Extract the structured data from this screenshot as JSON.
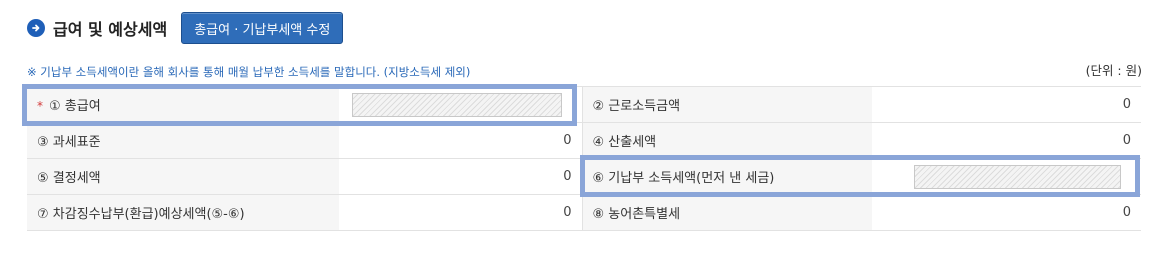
{
  "section": {
    "title": "급여 및 예상세액",
    "edit_button": "총급여 · 기납부세액 수정"
  },
  "notice": "※ 기납부 소득세액이란 올해 회사를 통해 매월 납부한 소득세를 말합니다. (지방소득세 제외)",
  "unit": "(단위 : 원)",
  "rows": [
    {
      "left_label": "① 총급여",
      "left_required_mark": "*",
      "left_value": "",
      "right_label": "② 근로소득금액",
      "right_value": "0"
    },
    {
      "left_label": "③ 과세표준",
      "left_value": "0",
      "right_label": "④ 산출세액",
      "right_value": "0"
    },
    {
      "left_label": "⑤ 결정세액",
      "left_value": "0",
      "right_label": "⑥ 기납부 소득세액(먼저 낸 세금)",
      "right_value": ""
    },
    {
      "left_label": "⑦ 차감징수납부(환급)예상세액(⑤-⑥)",
      "left_value": "0",
      "right_label": "⑧ 농어촌특별세",
      "right_value": "0"
    }
  ],
  "colors": {
    "accent": "#2f6db9",
    "highlight": "#8aa5d8",
    "required": "#d23a3a"
  },
  "icons": {
    "section_icon": "arrow-right-circle-icon"
  }
}
